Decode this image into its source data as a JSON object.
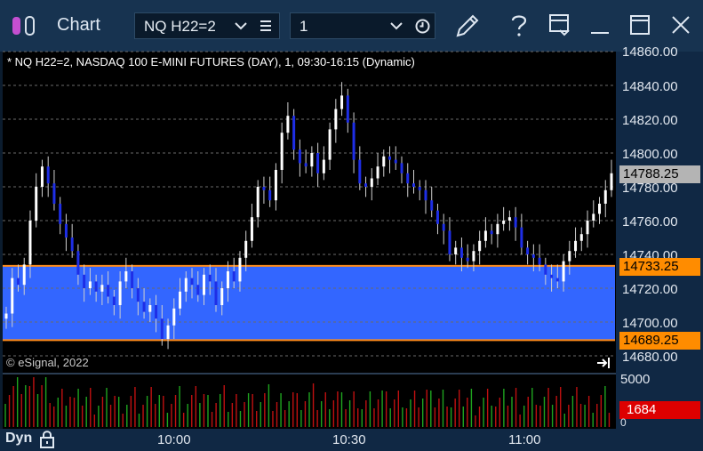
{
  "window": {
    "title": "Chart",
    "symbol": "NQ H22=2",
    "interval": "1"
  },
  "chart_info": "* NQ H22=2, NASDAQ 100 E-MINI FUTURES (DAY), 1, 09:30-16:15 (Dynamic)",
  "copyright": "© eSignal, 2022",
  "price_axis": {
    "ticks": [
      "14860.00",
      "14840.00",
      "14820.00",
      "14800.00",
      "14780.00",
      "14760.00",
      "14740.00",
      "14720.00",
      "14700.00",
      "14680.00"
    ]
  },
  "price_tags": {
    "last": "14788.25",
    "upper_line": "14733.25",
    "lower_line": "14689.25"
  },
  "volume_axis": {
    "tick": "5000",
    "zero": "0",
    "last_volume": "1684"
  },
  "time_axis": {
    "ticks": [
      "10:00",
      "10:30",
      "11:00"
    ],
    "mode": "Dyn"
  },
  "colors": {
    "band": "#3366ff",
    "band_line": "#ff8c1a",
    "up_candle": "#ffffff",
    "down_candle": "#1e2ee6",
    "tag_last": "#b4b4b4",
    "tag_orange": "#ff8c00",
    "tag_volume": "#dd0000"
  },
  "chart_data": {
    "type": "candlestick",
    "title": "* NQ H22=2, NASDAQ 100 E-MINI FUTURES (DAY), 1, 09:30-16:15 (Dynamic)",
    "y_range": [
      14680,
      14860
    ],
    "band": {
      "upper": 14733.25,
      "lower": 14689.25
    },
    "last": 14788.25,
    "closes": [
      14705,
      14726,
      14722,
      14734,
      14760,
      14780,
      14792,
      14782,
      14770,
      14758,
      14750,
      14742,
      14728,
      14720,
      14724,
      14718,
      14722,
      14715,
      14710,
      14724,
      14730,
      14720,
      14712,
      14706,
      14710,
      14702,
      14690,
      14698,
      14708,
      14718,
      14726,
      14722,
      14716,
      14728,
      14724,
      14710,
      14720,
      14730,
      14724,
      14738,
      14748,
      14762,
      14780,
      14778,
      14772,
      14790,
      14812,
      14822,
      14802,
      14794,
      14792,
      14800,
      14788,
      14796,
      14814,
      14826,
      14834,
      14818,
      14796,
      14782,
      14780,
      14785,
      14792,
      14798,
      14796,
      14794,
      14788,
      14782,
      14780,
      14778,
      14772,
      14766,
      14758,
      14754,
      14740,
      14744,
      14738,
      14736,
      14742,
      14748,
      14754,
      14752,
      14758,
      14760,
      14762,
      14756,
      14744,
      14740,
      14738,
      14734,
      14728,
      14726,
      14724,
      14736,
      14742,
      14748,
      14752,
      14760,
      14764,
      14770,
      14778,
      14788
    ],
    "volume_max_tick": 5000,
    "last_volume": 1684
  }
}
